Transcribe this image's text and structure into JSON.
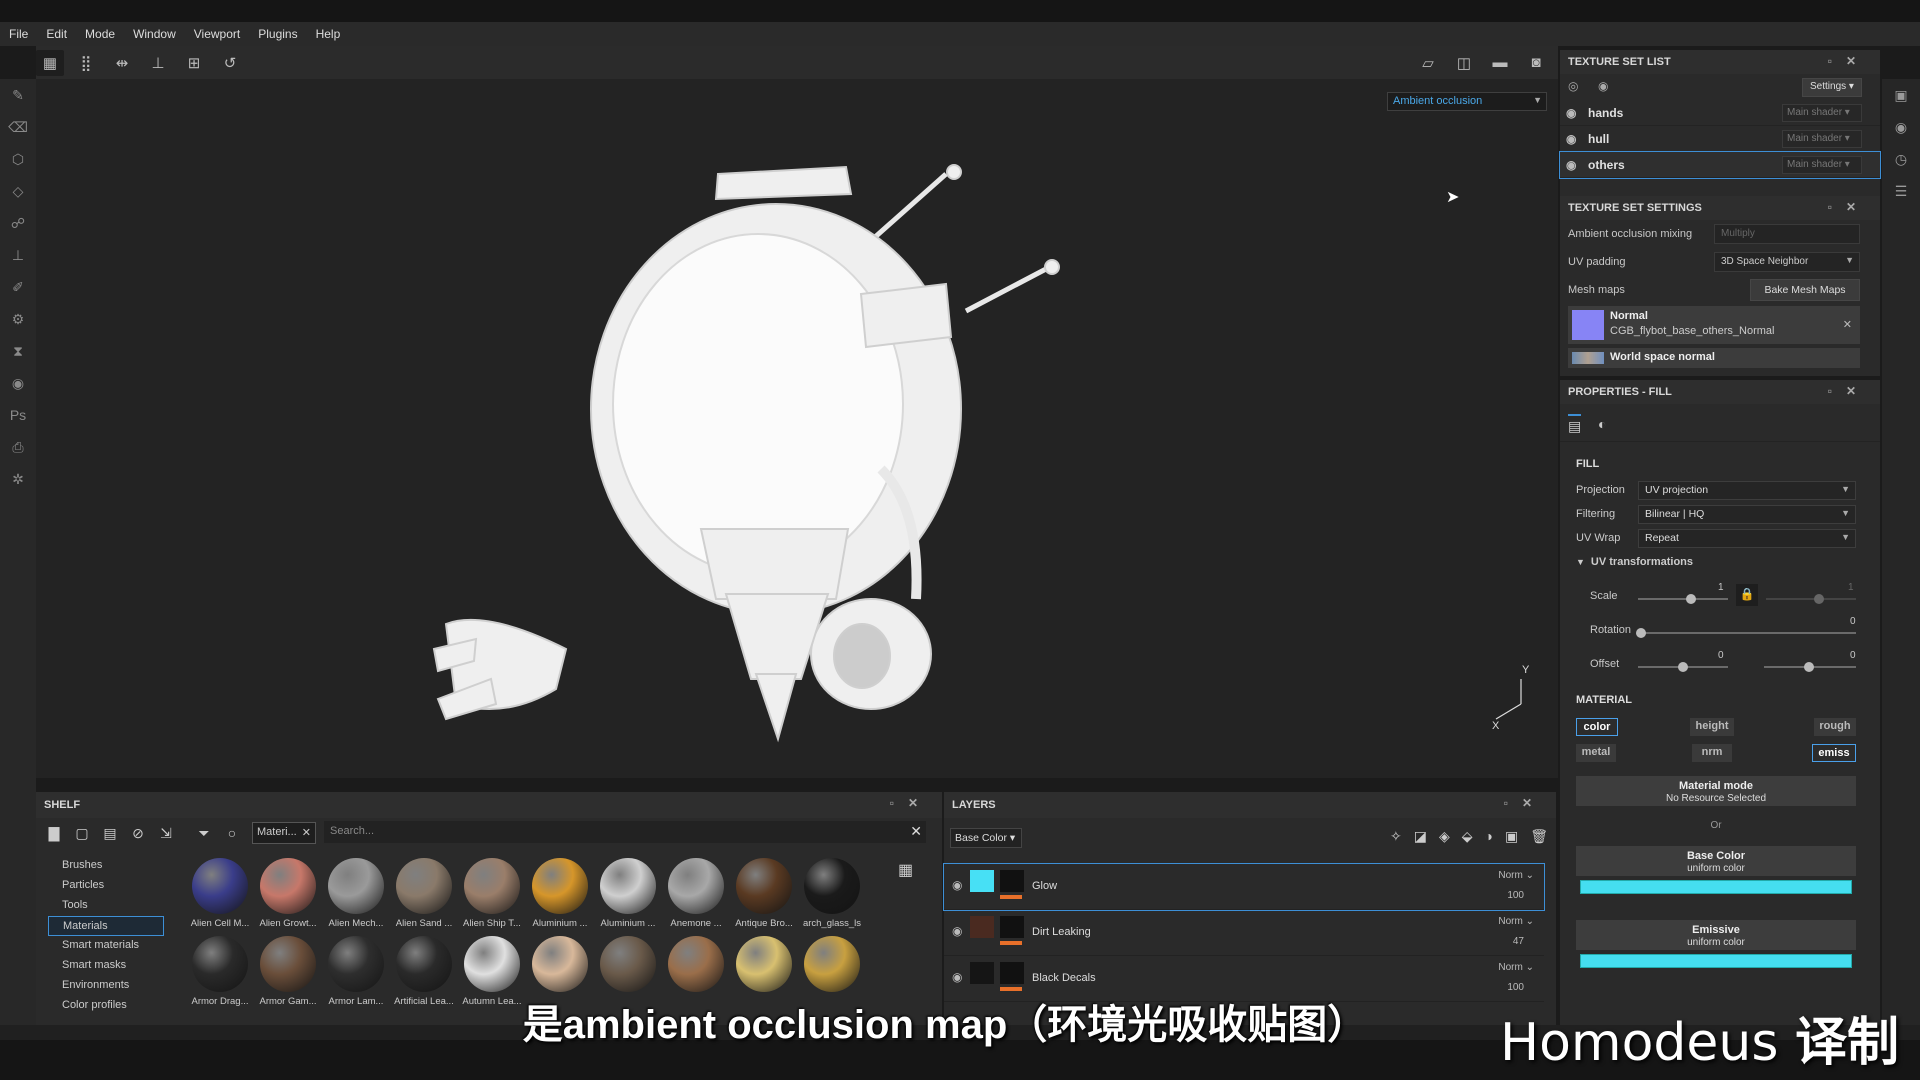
{
  "menu": [
    "File",
    "Edit",
    "Mode",
    "Window",
    "Viewport",
    "Plugins",
    "Help"
  ],
  "viewport": {
    "channel_select": "Ambient occlusion",
    "axis_x": "X",
    "axis_y": "Y"
  },
  "texture_set_list": {
    "title": "TEXTURE SET LIST",
    "settings_label": "Settings",
    "items": [
      {
        "name": "hands",
        "shader": "Main shader"
      },
      {
        "name": "hull",
        "shader": "Main shader"
      },
      {
        "name": "others",
        "shader": "Main shader"
      }
    ]
  },
  "texture_set_settings": {
    "title": "TEXTURE SET SETTINGS",
    "ao_mixing_label": "Ambient occlusion mixing",
    "ao_mixing_value": "Multiply",
    "uv_padding_label": "UV padding",
    "uv_padding_value": "3D Space Neighbor",
    "mesh_maps_label": "Mesh maps",
    "bake_button": "Bake Mesh Maps",
    "maps": [
      {
        "title": "Normal",
        "file": "CGB_flybot_base_others_Normal"
      },
      {
        "title": "World space normal",
        "file": ""
      }
    ]
  },
  "properties": {
    "title": "PROPERTIES - FILL",
    "fill_section": "FILL",
    "projection_label": "Projection",
    "projection_value": "UV projection",
    "filtering_label": "Filtering",
    "filtering_value": "Bilinear | HQ",
    "uvwrap_label": "UV Wrap",
    "uvwrap_value": "Repeat",
    "uv_transform_label": "UV transformations",
    "scale_label": "Scale",
    "scale_value": "1",
    "scale_value2": "1",
    "rotation_label": "Rotation",
    "rotation_value": "0",
    "offset_label": "Offset",
    "offset_value1": "0",
    "offset_value2": "0",
    "material_section": "MATERIAL",
    "channels": [
      "color",
      "height",
      "rough",
      "metal",
      "nrm",
      "emiss"
    ],
    "material_mode_title": "Material mode",
    "material_mode_sub": "No Resource Selected",
    "or_label": "Or",
    "base_color_title": "Base Color",
    "base_color_sub": "uniform color",
    "emissive_title": "Emissive",
    "emissive_sub": "uniform color",
    "swatch_color": "#45def0"
  },
  "shelf": {
    "title": "SHELF",
    "filter_chip": "Materi...",
    "search_placeholder": "Search...",
    "categories": [
      "Brushes",
      "Particles",
      "Tools",
      "Materials",
      "Smart materials",
      "Smart masks",
      "Environments",
      "Color profiles"
    ],
    "row1": [
      "Alien Cell M...",
      "Alien Growt...",
      "Alien Mech...",
      "Alien Sand ...",
      "Alien Ship T...",
      "Aluminium ...",
      "Aluminium ...",
      "Anemone ...",
      "Antique Bro...",
      "arch_glass_ls"
    ],
    "row2": [
      "Armor Drag...",
      "Armor Gam...",
      "Armor Lam...",
      "Artificial Lea...",
      "Autumn Lea...",
      "",
      "",
      "",
      "",
      ""
    ]
  },
  "layers": {
    "title": "LAYERS",
    "channel": "Base Color",
    "items": [
      {
        "name": "Glow",
        "blend": "Norm",
        "opacity": "100"
      },
      {
        "name": "Dirt Leaking",
        "blend": "Norm",
        "opacity": "47"
      },
      {
        "name": "Black Decals",
        "blend": "Norm",
        "opacity": "100"
      }
    ]
  },
  "subtitle": "是ambient occlusion map（环境光吸收贴图）",
  "watermark": {
    "name": "Homodeus",
    "suffix": "译制"
  }
}
